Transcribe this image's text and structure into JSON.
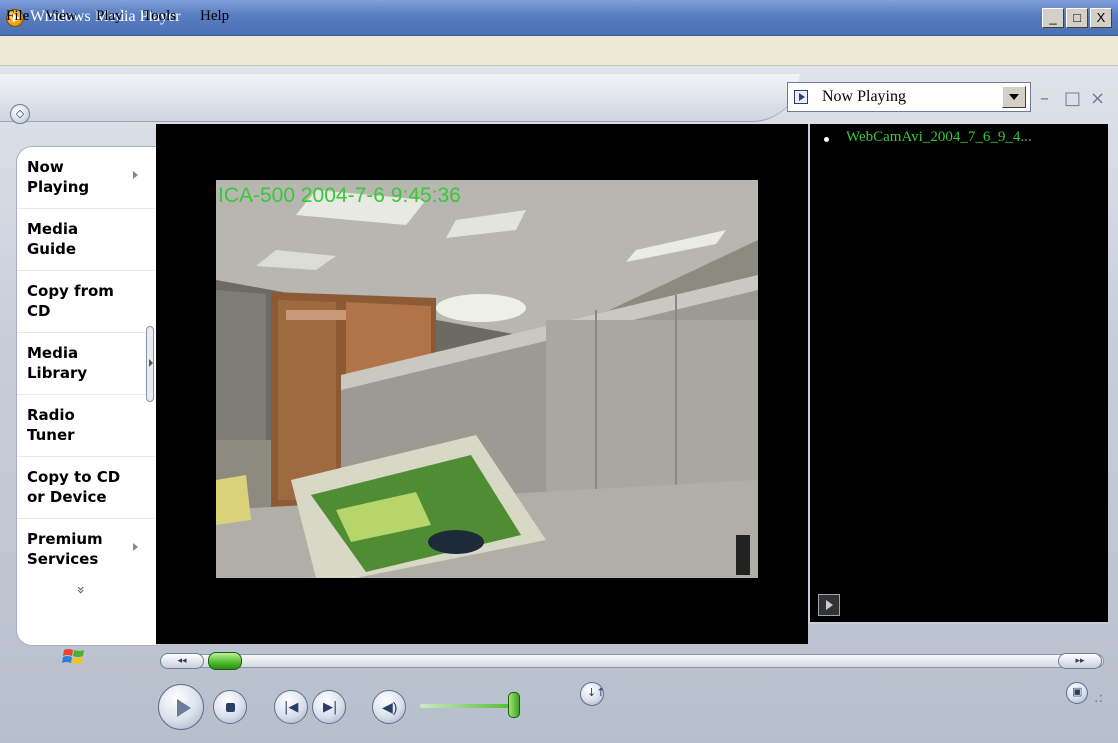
{
  "window": {
    "title": "Windows Media Player",
    "controls": {
      "minimize": "_",
      "maximize": "□",
      "close": "X"
    }
  },
  "menu": {
    "items": [
      "File",
      "View",
      "Play",
      "Tools",
      "Help"
    ]
  },
  "sidebar": {
    "items": [
      {
        "label": "Now Playing",
        "has_arrow": true
      },
      {
        "label": "Media Guide",
        "has_arrow": false
      },
      {
        "label": "Copy from CD",
        "has_arrow": false
      },
      {
        "label": "Media Library",
        "has_arrow": false
      },
      {
        "label": "Radio Tuner",
        "has_arrow": false
      },
      {
        "label": "Copy to CD or Device",
        "has_arrow": false
      },
      {
        "label": "Premium Services",
        "has_arrow": true
      }
    ],
    "more_glyph": "»"
  },
  "video": {
    "overlay_text": "ICA-500  2004-7-6 9:45:36"
  },
  "playlist": {
    "selected": "Now Playing",
    "window_controls": {
      "minimize": "–",
      "restore": "□",
      "close": "×"
    },
    "items": [
      "WebCamAvi_2004_7_6_9_4..."
    ]
  },
  "seek": {
    "rewind_glyph": "◂◂",
    "forward_glyph": "▸▸"
  },
  "colors": {
    "overlay_green": "#38c838",
    "accent_green": "#4cbb2a",
    "titlebar_blue": "#5a7fc2"
  }
}
